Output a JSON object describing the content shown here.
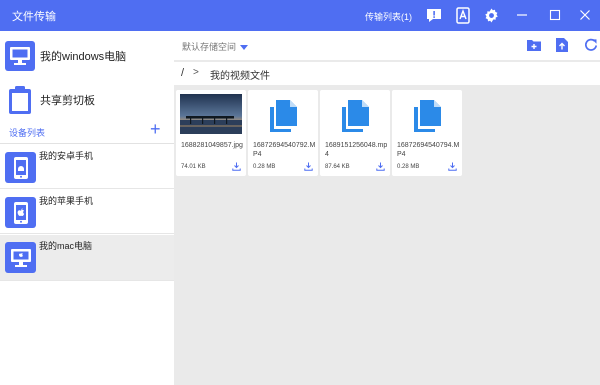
{
  "window": {
    "title": "文件传输",
    "transfer_list": "传输列表(1)"
  },
  "sidebar": {
    "my_pc": "我的windows电脑",
    "clipboard": "共享剪切板",
    "device_list_label": "设备列表",
    "add_symbol": "+",
    "devices": [
      {
        "label": "我的安卓手机",
        "icon": "android-icon"
      },
      {
        "label": "我的苹果手机",
        "icon": "apple-icon"
      },
      {
        "label": "我的mac电脑",
        "icon": "apple-desktop-icon"
      }
    ]
  },
  "toolbar": {
    "storage_label": "默认存储空间"
  },
  "path": {
    "root": "/",
    "separator": ">",
    "current": "我的视频文件"
  },
  "files": [
    {
      "name": "1688281049857.jpg",
      "size": "74.01  KB",
      "type": "image"
    },
    {
      "name": "16872694540792.MP4",
      "size": "0.28  MB",
      "type": "video"
    },
    {
      "name": "1689151256048.mp4",
      "size": "87.64  KB",
      "type": "video"
    },
    {
      "name": "16872694540794.MP4",
      "size": "0.28  MB",
      "type": "video"
    }
  ],
  "colors": {
    "accent": "#4f6ef2",
    "file_icon": "#2b8ae8"
  }
}
